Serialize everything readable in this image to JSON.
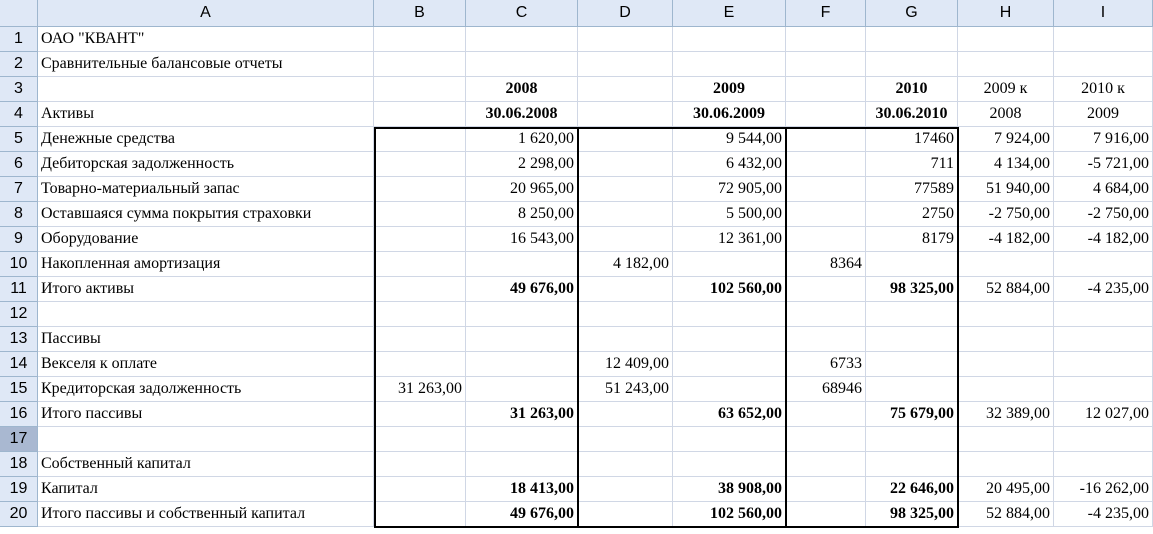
{
  "columns": [
    "A",
    "B",
    "C",
    "D",
    "E",
    "F",
    "G",
    "H",
    "I"
  ],
  "rows": [
    {
      "n": "1",
      "A": "ОАО \"КВАНТ\"",
      "B": "",
      "C": "",
      "D": "",
      "E": "",
      "F": "",
      "G": "",
      "H": "",
      "I": ""
    },
    {
      "n": "2",
      "A": "Сравнительные балансовые отчеты",
      "B": "",
      "C": "",
      "D": "",
      "E": "",
      "F": "",
      "G": "",
      "H": "",
      "I": ""
    },
    {
      "n": "3",
      "A": "",
      "B": "",
      "C": "2008",
      "D": "",
      "E": "2009",
      "F": "",
      "G": "2010",
      "H": "2009 к",
      "I": "2010 к"
    },
    {
      "n": "4",
      "A": "Активы",
      "B": "",
      "C": "30.06.2008",
      "D": "",
      "E": "30.06.2009",
      "F": "",
      "G": "30.06.2010",
      "H": "2008",
      "I": "2009"
    },
    {
      "n": "5",
      "A": "Денежные средства",
      "B": "",
      "C": "1 620,00",
      "D": "",
      "E": "9 544,00",
      "F": "",
      "G": "17460",
      "H": "7 924,00",
      "I": "7 916,00"
    },
    {
      "n": "6",
      "A": "Дебиторская задолженность",
      "B": "",
      "C": "2 298,00",
      "D": "",
      "E": "6 432,00",
      "F": "",
      "G": "711",
      "H": "4 134,00",
      "I": "-5 721,00"
    },
    {
      "n": "7",
      "A": "Товарно-материальный запас",
      "B": "",
      "C": "20 965,00",
      "D": "",
      "E": "72 905,00",
      "F": "",
      "G": "77589",
      "H": "51 940,00",
      "I": "4 684,00"
    },
    {
      "n": "8",
      "A": "Оставшаяся сумма покрытия страховки",
      "B": "",
      "C": "8 250,00",
      "D": "",
      "E": "5 500,00",
      "F": "",
      "G": "2750",
      "H": "-2 750,00",
      "I": "-2 750,00"
    },
    {
      "n": "9",
      "A": "Оборудование",
      "B": "",
      "C": "16 543,00",
      "D": "",
      "E": "12 361,00",
      "F": "",
      "G": "8179",
      "H": "-4 182,00",
      "I": "-4 182,00"
    },
    {
      "n": "10",
      "A": "Накопленная амортизация",
      "B": "",
      "C": "",
      "D": "4 182,00",
      "E": "",
      "F": "8364",
      "G": "",
      "H": "",
      "I": ""
    },
    {
      "n": "11",
      "A": "Итого активы",
      "B": "",
      "C": "49 676,00",
      "D": "",
      "E": "102 560,00",
      "F": "",
      "G": "98 325,00",
      "H": "52 884,00",
      "I": "-4 235,00"
    },
    {
      "n": "12",
      "A": "",
      "B": "",
      "C": "",
      "D": "",
      "E": "",
      "F": "",
      "G": "",
      "H": "",
      "I": ""
    },
    {
      "n": "13",
      "A": "Пассивы",
      "B": "",
      "C": "",
      "D": "",
      "E": "",
      "F": "",
      "G": "",
      "H": "",
      "I": ""
    },
    {
      "n": "14",
      "A": "Векселя к оплате",
      "B": "",
      "C": "",
      "D": "12 409,00",
      "E": "",
      "F": "6733",
      "G": "",
      "H": "",
      "I": ""
    },
    {
      "n": "15",
      "A": "Кредиторская задолженность",
      "B": "31 263,00",
      "C": "",
      "D": "51 243,00",
      "E": "",
      "F": "68946",
      "G": "",
      "H": "",
      "I": ""
    },
    {
      "n": "16",
      "A": "Итого пассивы",
      "B": "",
      "C": "31 263,00",
      "D": "",
      "E": "63 652,00",
      "F": "",
      "G": "75 679,00",
      "H": "32 389,00",
      "I": "12 027,00"
    },
    {
      "n": "17",
      "A": "",
      "B": "",
      "C": "",
      "D": "",
      "E": "",
      "F": "",
      "G": "",
      "H": "",
      "I": ""
    },
    {
      "n": "18",
      "A": "Собственный капитал",
      "B": "",
      "C": "",
      "D": "",
      "E": "",
      "F": "",
      "G": "",
      "H": "",
      "I": ""
    },
    {
      "n": "19",
      "A": "Капитал",
      "B": "",
      "C": "18 413,00",
      "D": "",
      "E": "38 908,00",
      "F": "",
      "G": "22 646,00",
      "H": "20 495,00",
      "I": "-16 262,00"
    },
    {
      "n": "20",
      "A": "Итого пассивы и собственный капитал",
      "B": "",
      "C": "49 676,00",
      "D": "",
      "E": "102 560,00",
      "F": "",
      "G": "98 325,00",
      "H": "52 884,00",
      "I": "-4 235,00"
    }
  ]
}
